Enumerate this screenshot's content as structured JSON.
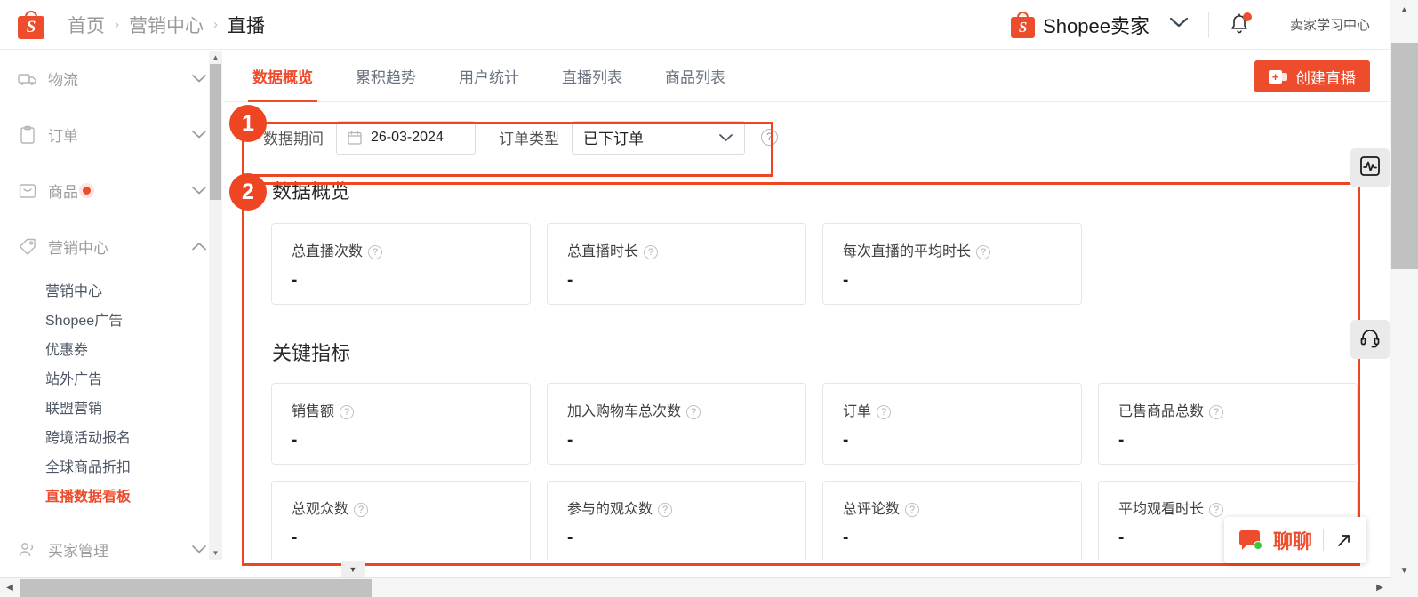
{
  "header": {
    "logo_letter": "S",
    "breadcrumb": [
      {
        "label": "首页",
        "active": false
      },
      {
        "label": "营销中心",
        "active": false
      },
      {
        "label": "直播",
        "active": true
      }
    ],
    "separator": "›",
    "account_name": "Shopee卖家",
    "account_caret_icon": "chevron-down-icon",
    "notification_icon": "bell-icon",
    "has_notification_dot": true,
    "learning_center": "卖家学习中心"
  },
  "sidebar": {
    "groups": [
      {
        "label": "物流",
        "icon": "truck-icon",
        "expanded": false,
        "dot": false,
        "children": []
      },
      {
        "label": "订单",
        "icon": "clipboard-icon",
        "expanded": false,
        "dot": false,
        "children": []
      },
      {
        "label": "商品",
        "icon": "box-icon",
        "expanded": false,
        "dot": true,
        "children": []
      },
      {
        "label": "营销中心",
        "icon": "tag-icon",
        "expanded": true,
        "dot": false,
        "children": [
          {
            "label": "营销中心",
            "active": false
          },
          {
            "label": "Shopee广告",
            "active": false
          },
          {
            "label": "优惠券",
            "active": false
          },
          {
            "label": "站外广告",
            "active": false
          },
          {
            "label": "联盟营销",
            "active": false
          },
          {
            "label": "跨境活动报名",
            "active": false
          },
          {
            "label": "全球商品折扣",
            "active": false
          },
          {
            "label": "直播数据看板",
            "active": true
          }
        ]
      },
      {
        "label": "买家管理",
        "icon": "people-icon",
        "expanded": false,
        "dot": false,
        "children": []
      }
    ]
  },
  "tabs": [
    {
      "label": "数据概览",
      "active": true
    },
    {
      "label": "累积趋势",
      "active": false
    },
    {
      "label": "用户统计",
      "active": false
    },
    {
      "label": "直播列表",
      "active": false
    },
    {
      "label": "商品列表",
      "active": false
    }
  ],
  "create_button": {
    "label": "创建直播",
    "icon": "video-plus-icon"
  },
  "filters": {
    "period_label": "数据期间",
    "date_value": "26-03-2024",
    "date_icon": "calendar-icon",
    "order_type_label": "订单类型",
    "order_type_value": "已下订单",
    "order_type_caret": "chevron-down-icon",
    "help_icon": "question-circle-icon"
  },
  "overview": {
    "title": "数据概览",
    "cards": [
      {
        "label": "总直播次数",
        "value": "-",
        "help": "question-circle-icon"
      },
      {
        "label": "总直播时长",
        "value": "-",
        "help": "question-circle-icon"
      },
      {
        "label": "每次直播的平均时长",
        "value": "-",
        "help": "question-circle-icon"
      }
    ]
  },
  "key_metrics": {
    "title": "关键指标",
    "row1": [
      {
        "label": "销售额",
        "value": "-",
        "help": "question-circle-icon"
      },
      {
        "label": "加入购物车总次数",
        "value": "-",
        "help": "question-circle-icon"
      },
      {
        "label": "订单",
        "value": "-",
        "help": "question-circle-icon"
      },
      {
        "label": "已售商品总数",
        "value": "-",
        "help": "question-circle-icon"
      }
    ],
    "row2": [
      {
        "label": "总观众数",
        "value": "-",
        "help": "question-circle-icon"
      },
      {
        "label": "参与的观众数",
        "value": "-",
        "help": "question-circle-icon"
      },
      {
        "label": "总评论数",
        "value": "-",
        "help": "question-circle-icon"
      },
      {
        "label": "平均观看时长",
        "value": "-",
        "help": "question-circle-icon"
      }
    ]
  },
  "annotations": [
    {
      "number": "1",
      "target": "filter-row"
    },
    {
      "number": "2",
      "target": "data-overview-section"
    }
  ],
  "float_buttons": [
    {
      "name": "analytics-float",
      "icon": "chart-pulse-icon"
    },
    {
      "name": "support-float",
      "icon": "headset-icon"
    }
  ],
  "chat_widget": {
    "label": "聊聊",
    "bubble_icon": "chat-bubble-icon",
    "expand_icon": "expand-arrow-icon",
    "online": true
  },
  "scroll": {
    "up_arrow": "▲",
    "down_arrow": "▼",
    "left_arrow": "◀",
    "right_arrow": "▶",
    "small_caret": "▼"
  },
  "colors": {
    "brand": "#ee4d2d",
    "annotation": "#ee4522",
    "text": "#222222",
    "muted": "#9a9a9a",
    "border": "#e6e6e6"
  }
}
